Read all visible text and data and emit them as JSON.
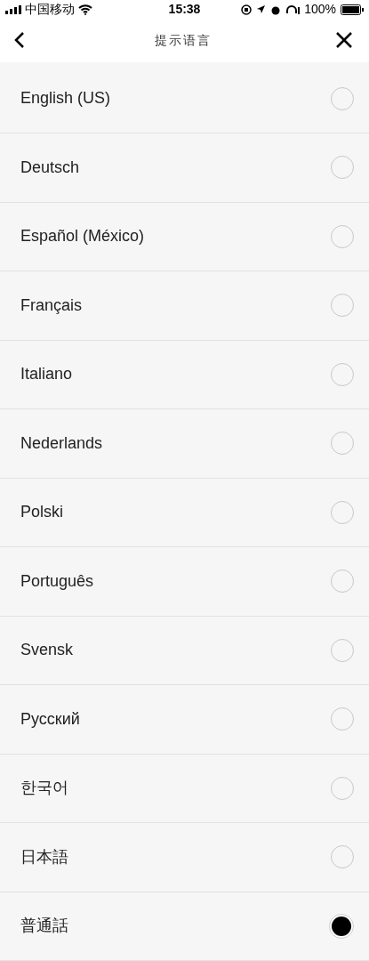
{
  "status_bar": {
    "carrier": "中国移动",
    "time": "15:38",
    "battery": "100%"
  },
  "header": {
    "title": "提示语言"
  },
  "languages": [
    {
      "label": "English (US)",
      "selected": false
    },
    {
      "label": "Deutsch",
      "selected": false
    },
    {
      "label": "Español (México)",
      "selected": false
    },
    {
      "label": "Français",
      "selected": false
    },
    {
      "label": "Italiano",
      "selected": false
    },
    {
      "label": "Nederlands",
      "selected": false
    },
    {
      "label": "Polski",
      "selected": false
    },
    {
      "label": "Português",
      "selected": false
    },
    {
      "label": "Svensk",
      "selected": false
    },
    {
      "label": "Русский",
      "selected": false
    },
    {
      "label": "한국어",
      "selected": false
    },
    {
      "label": "日本語",
      "selected": false
    },
    {
      "label": "普通話",
      "selected": true
    }
  ]
}
